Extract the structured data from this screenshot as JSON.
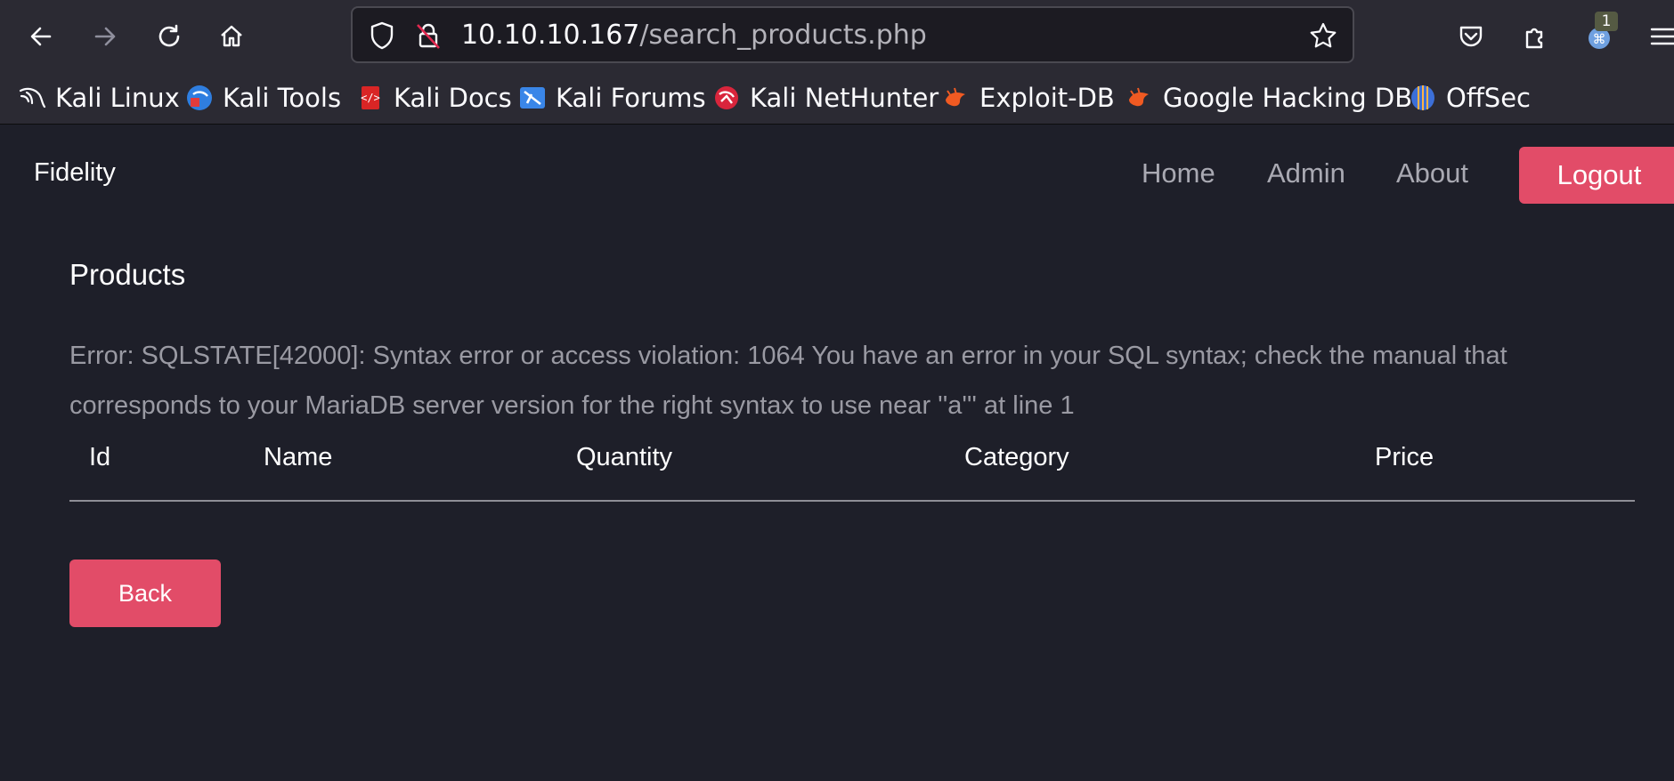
{
  "browser": {
    "url_host": "10.10.10.167",
    "url_path": "/search_products.php",
    "extension_badge": "1",
    "bookmarks": [
      {
        "label": "Kali Linux",
        "icon": "kali-dragon-icon"
      },
      {
        "label": "Kali Tools",
        "icon": "kali-tools-icon"
      },
      {
        "label": "Kali Docs",
        "icon": "kali-docs-icon"
      },
      {
        "label": "Kali Forums",
        "icon": "kali-forums-icon"
      },
      {
        "label": "Kali NetHunter",
        "icon": "kali-nethunter-icon"
      },
      {
        "label": "Exploit-DB",
        "icon": "exploit-db-icon"
      },
      {
        "label": "Google Hacking DB",
        "icon": "ghdb-icon"
      },
      {
        "label": "OffSec",
        "icon": "offsec-icon"
      }
    ]
  },
  "site": {
    "brand": "Fidelity",
    "nav": {
      "home": "Home",
      "admin": "Admin",
      "about": "About",
      "logout": "Logout"
    }
  },
  "main": {
    "heading": "Products",
    "error": "Error: SQLSTATE[42000]: Syntax error or access violation: 1064 You have an error in your SQL syntax; check the manual that corresponds to your MariaDB server version for the right syntax to use near ''a''' at line 1",
    "table": {
      "columns": [
        "Id",
        "Name",
        "Quantity",
        "Category",
        "Price"
      ]
    },
    "back_label": "Back"
  },
  "colors": {
    "page_bg": "#1e1f29",
    "chrome_bg": "#2b2a33",
    "accent": "#e24c68"
  }
}
